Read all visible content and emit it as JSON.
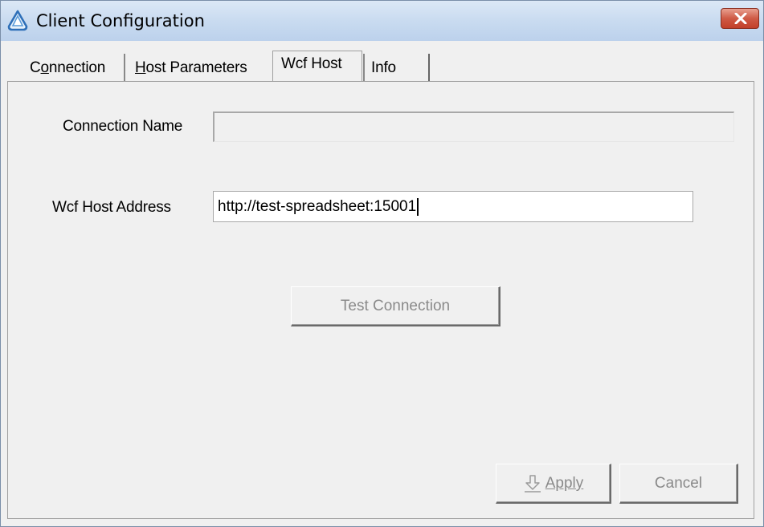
{
  "window": {
    "title": "Client Configuration"
  },
  "tabs": [
    {
      "label": "Connection",
      "mnemonic_index": 1,
      "active": false
    },
    {
      "label": "Host Parameters",
      "mnemonic_index": 0,
      "active": false
    },
    {
      "label": "Wcf Host",
      "active": true
    },
    {
      "label": "Info",
      "active": false
    }
  ],
  "form": {
    "connection_name_label": "Connection Name",
    "connection_name_value": "",
    "wcf_host_address_label": "Wcf Host Address",
    "wcf_host_address_value": "http://test-spreadsheet:15001",
    "test_connection_label": "Test Connection"
  },
  "footer": {
    "apply_label": "Apply",
    "cancel_label": "Cancel"
  },
  "icons": {
    "app": "client-config-icon",
    "close": "close-icon",
    "apply": "down-arrow-icon"
  },
  "colors": {
    "titlebar": "#c9dbf0",
    "close_button": "#c94a36",
    "disabled_text": "#8a8a8a"
  }
}
